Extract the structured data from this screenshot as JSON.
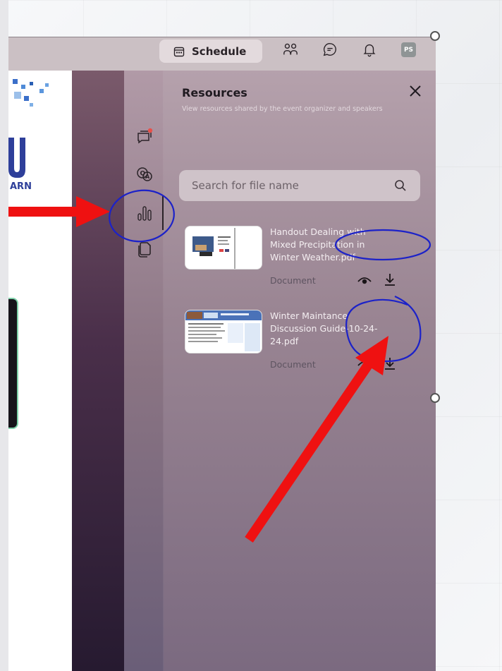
{
  "topbar": {
    "schedule_label": "Schedule",
    "avatar_initials": "PS"
  },
  "stage": {
    "logo_text": "ARN"
  },
  "resources_panel": {
    "title": "Resources",
    "subtitle": "View resources shared by the event organizer and speakers",
    "search_placeholder": "Search for file name",
    "items": [
      {
        "name": "Handout Dealing with Mixed Precipitation in Winter Weather.pdf",
        "type": "Document"
      },
      {
        "name": "Winter Maintance Discussion Guide-10-24-24.pdf",
        "type": "Document"
      }
    ]
  },
  "colors": {
    "annotation_arrow": "#ef1111",
    "annotation_circle": "#1c22c8",
    "panel_bg_top": "#b5a1ac",
    "panel_bg_bottom": "#7b6a80",
    "topbar_bg": "#cbc0c4",
    "notification_dot": "#e8504a"
  },
  "icons": {
    "schedule": "calendar-icon",
    "people": "people-icon",
    "chat": "chat-bubble-icon",
    "notifications": "bell-icon",
    "rail_chat": "chat-notification-icon",
    "rail_qa": "qa-icon",
    "rail_polls": "polls-icon",
    "rail_resources": "document-icon",
    "close": "close-icon",
    "search": "search-icon",
    "view": "eye-icon",
    "download": "download-icon"
  }
}
